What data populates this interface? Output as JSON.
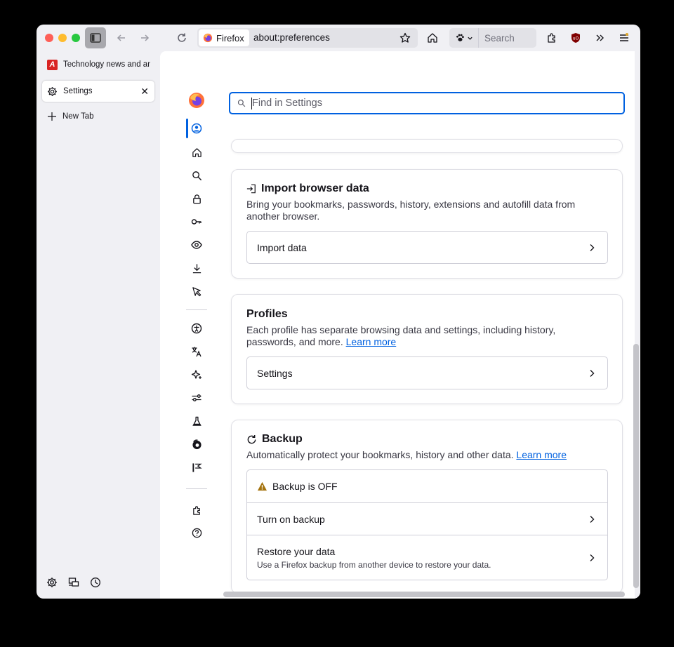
{
  "toolbar": {
    "identity_label": "Firefox",
    "url": "about:preferences",
    "search_placeholder": "Search"
  },
  "tabs": [
    {
      "title": "Technology news and analysis",
      "active": false
    },
    {
      "title": "Settings",
      "active": true,
      "close": "✕"
    },
    {
      "title": "New Tab",
      "active": false
    }
  ],
  "settings": {
    "find_placeholder": "Find in Settings",
    "import": {
      "title": "Import browser data",
      "description": "Bring your bookmarks, passwords, history, extensions and autofill data from another browser.",
      "button": "Import data"
    },
    "profiles": {
      "title": "Profiles",
      "description": "Each profile has separate browsing data and settings, including history, passwords, and more.",
      "learn_more": "Learn more",
      "button": "Settings"
    },
    "backup": {
      "title": "Backup",
      "description": "Automatically protect your bookmarks, history and other data.",
      "learn_more": "Learn more",
      "status": "Backup is OFF",
      "turn_on": "Turn on backup",
      "restore_title": "Restore your data",
      "restore_sub": "Use a Firefox backup from another device to restore your data."
    }
  },
  "colors": {
    "accent": "#0061e0",
    "warning": "#a4730e",
    "frame": "#f0f0f4"
  }
}
